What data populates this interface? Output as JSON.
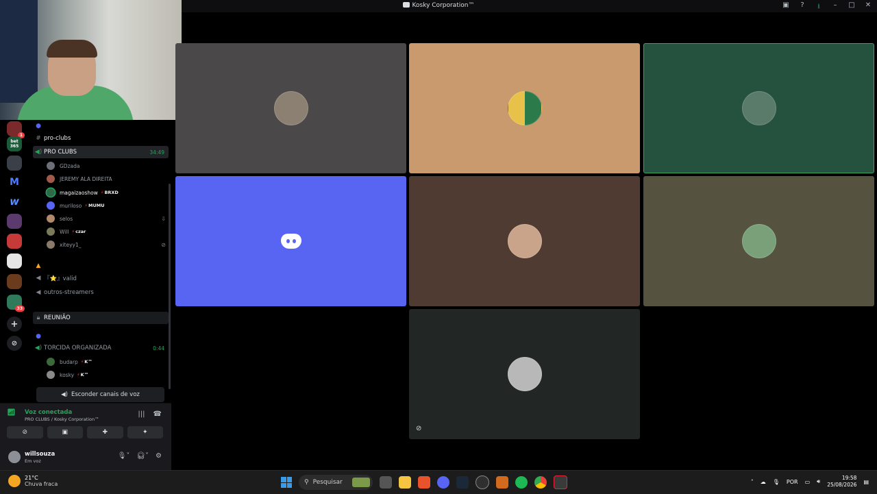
{
  "window": {
    "title": "Kosky Corporation™"
  },
  "servers": [
    {
      "name": "server-1",
      "badge": "1",
      "color": "#7a2a2a"
    },
    {
      "name": "bet365",
      "label": "bet 365",
      "color": "#1a5c3a"
    },
    {
      "name": "server-3",
      "color": "#3a3f48"
    },
    {
      "name": "server-m",
      "label": "M",
      "color": "#000"
    },
    {
      "name": "server-w",
      "label": "w",
      "color": "#000"
    },
    {
      "name": "server-6",
      "color": "#5b3a6e"
    },
    {
      "name": "server-7",
      "color": "#c73a3a"
    },
    {
      "name": "server-8",
      "color": "#e5e5e5"
    },
    {
      "name": "server-9",
      "color": "#6a3b1c"
    },
    {
      "name": "server-10",
      "badge": "33",
      "color": "#2f7a5a"
    }
  ],
  "channels": {
    "text_pro_clubs": "pro-clubs",
    "voice_pro_clubs": {
      "label": "PRO CLUBS",
      "timer": "34:49"
    },
    "pro_clubs_users": [
      {
        "name": "GDzada",
        "tag": ""
      },
      {
        "name": "JEREMY ALA DIREITA",
        "tag": ""
      },
      {
        "name": "magaizaoshow",
        "tag": "BRXD"
      },
      {
        "name": "muriloso",
        "tag": "MUMU"
      },
      {
        "name": "selos",
        "tag": ""
      },
      {
        "name": "Will",
        "tag": "czar"
      },
      {
        "name": "xiteyy1_",
        "tag": ""
      }
    ],
    "valid": "『⭐』valid",
    "outros": "outros-streamers",
    "reuniao": "REUNIÃO",
    "torcida": {
      "label": "TORCIDA ORGANIZADA",
      "timer": "0:44"
    },
    "torcida_users": [
      {
        "name": "budarp",
        "tag": "K™"
      },
      {
        "name": "kosky",
        "tag": "K™"
      }
    ]
  },
  "hide_voice_button": "Esconder canais de voz",
  "voice": {
    "status": "Voz conectada",
    "channel": "PRO CLUBS / Kosky Corporation™"
  },
  "user": {
    "name": "willsouza",
    "status": "Em voz"
  },
  "tiles": [
    {
      "bg": "#4a4848"
    },
    {
      "bg": "#c89a6e"
    },
    {
      "bg": "#24523f",
      "highlight": true
    },
    {
      "bg": "#5865f2",
      "discord": true
    },
    {
      "bg": "#4f3b31"
    },
    {
      "bg": "#55523f"
    },
    {
      "bg": "#222624",
      "muted": true
    }
  ],
  "taskbar": {
    "temp": "21°C",
    "weather": "Chuva fraca",
    "search": "Pesquisar",
    "lang": "POR",
    "time": "19:58",
    "date": "25/08/2026"
  }
}
